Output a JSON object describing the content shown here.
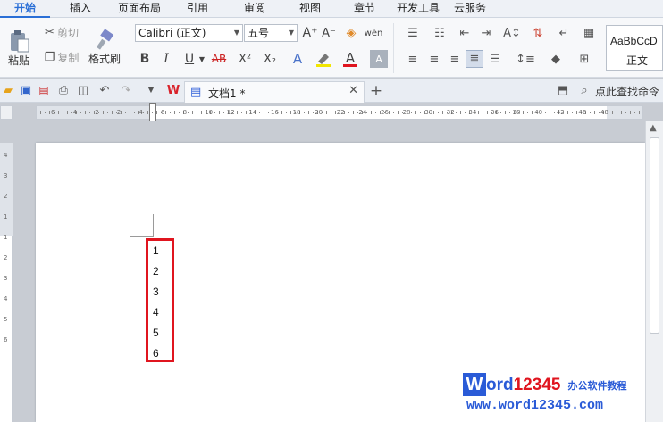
{
  "menu": {
    "tabs": [
      "开始",
      "插入",
      "页面布局",
      "引用",
      "审阅",
      "视图",
      "章节",
      "开发工具",
      "云服务"
    ],
    "active": "开始"
  },
  "clipboard": {
    "paste_label": "粘贴",
    "cut_label": "剪切",
    "copy_label": "复制",
    "format_painter_label": "格式刷"
  },
  "font": {
    "family": "Calibri (正文)",
    "size": "五号",
    "bold": "B",
    "italic": "I",
    "underline": "U",
    "strike": "AB",
    "superscript": "X²",
    "subscript": "X₂",
    "grow": "A⁺",
    "shrink": "A⁻",
    "clear": "A",
    "font_color": "A"
  },
  "styles": {
    "sample": "AaBbCcD",
    "name": "正文"
  },
  "document": {
    "tab_title": "文档1 *"
  },
  "search": {
    "label": "点此查找命令"
  },
  "rulers": {
    "horizontal": [
      "6",
      "4",
      "2",
      "2",
      "4",
      "6",
      "8",
      "10",
      "12",
      "14",
      "16",
      "18",
      "20",
      "22",
      "24",
      "26",
      "28",
      "30",
      "32",
      "34",
      "36",
      "38",
      "40",
      "42",
      "46",
      "48"
    ],
    "vertical": [
      "4",
      "3",
      "2",
      "1",
      "1",
      "2",
      "3",
      "4",
      "5",
      "6"
    ]
  },
  "page": {
    "lines": [
      "1",
      "2",
      "3",
      "4",
      "5",
      "6"
    ]
  },
  "watermark": {
    "w": "W",
    "ord": "ord",
    "num": "12345",
    "cn": "办公软件教程",
    "url": "www.word12345.com"
  },
  "colors": {
    "accent": "#2a6fd6",
    "highlight_border": "#e0151f",
    "watermark_blue": "#2a5bd7"
  }
}
